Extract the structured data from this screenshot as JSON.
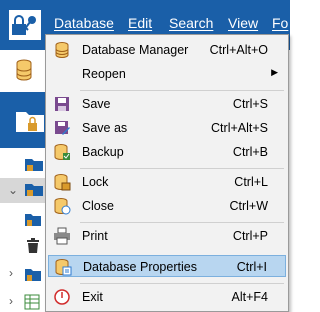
{
  "menubar": {
    "items": [
      {
        "label": "Database"
      },
      {
        "label": "Edit"
      },
      {
        "label": "Search"
      },
      {
        "label": "View"
      },
      {
        "label": "Fo"
      }
    ]
  },
  "menu": {
    "items": [
      {
        "label": "Database Manager",
        "shortcut": "Ctrl+Alt+O",
        "icon": "database-icon"
      },
      {
        "label": "Reopen",
        "shortcut": "",
        "icon": "",
        "submenu": "▶"
      },
      {
        "label": "Save",
        "shortcut": "Ctrl+S",
        "icon": "save-icon"
      },
      {
        "label": "Save as",
        "shortcut": "Ctrl+Alt+S",
        "icon": "save-as-icon"
      },
      {
        "label": "Backup",
        "shortcut": "Ctrl+B",
        "icon": "backup-icon"
      },
      {
        "label": "Lock",
        "shortcut": "Ctrl+L",
        "icon": "lock-icon"
      },
      {
        "label": "Close",
        "shortcut": "Ctrl+W",
        "icon": "close-database-icon"
      },
      {
        "label": "Print",
        "shortcut": "Ctrl+P",
        "icon": "printer-icon"
      },
      {
        "label": "Database Properties",
        "shortcut": "Ctrl+I",
        "icon": "database-properties-icon"
      },
      {
        "label": "Exit",
        "shortcut": "Alt+F4",
        "icon": "power-icon"
      }
    ]
  },
  "colors": {
    "menubar_bg": "#1a5fa8",
    "menu_bg": "#f2f2f2",
    "highlight_bg": "#b8d6f0",
    "highlight_border": "#7cb0de"
  }
}
